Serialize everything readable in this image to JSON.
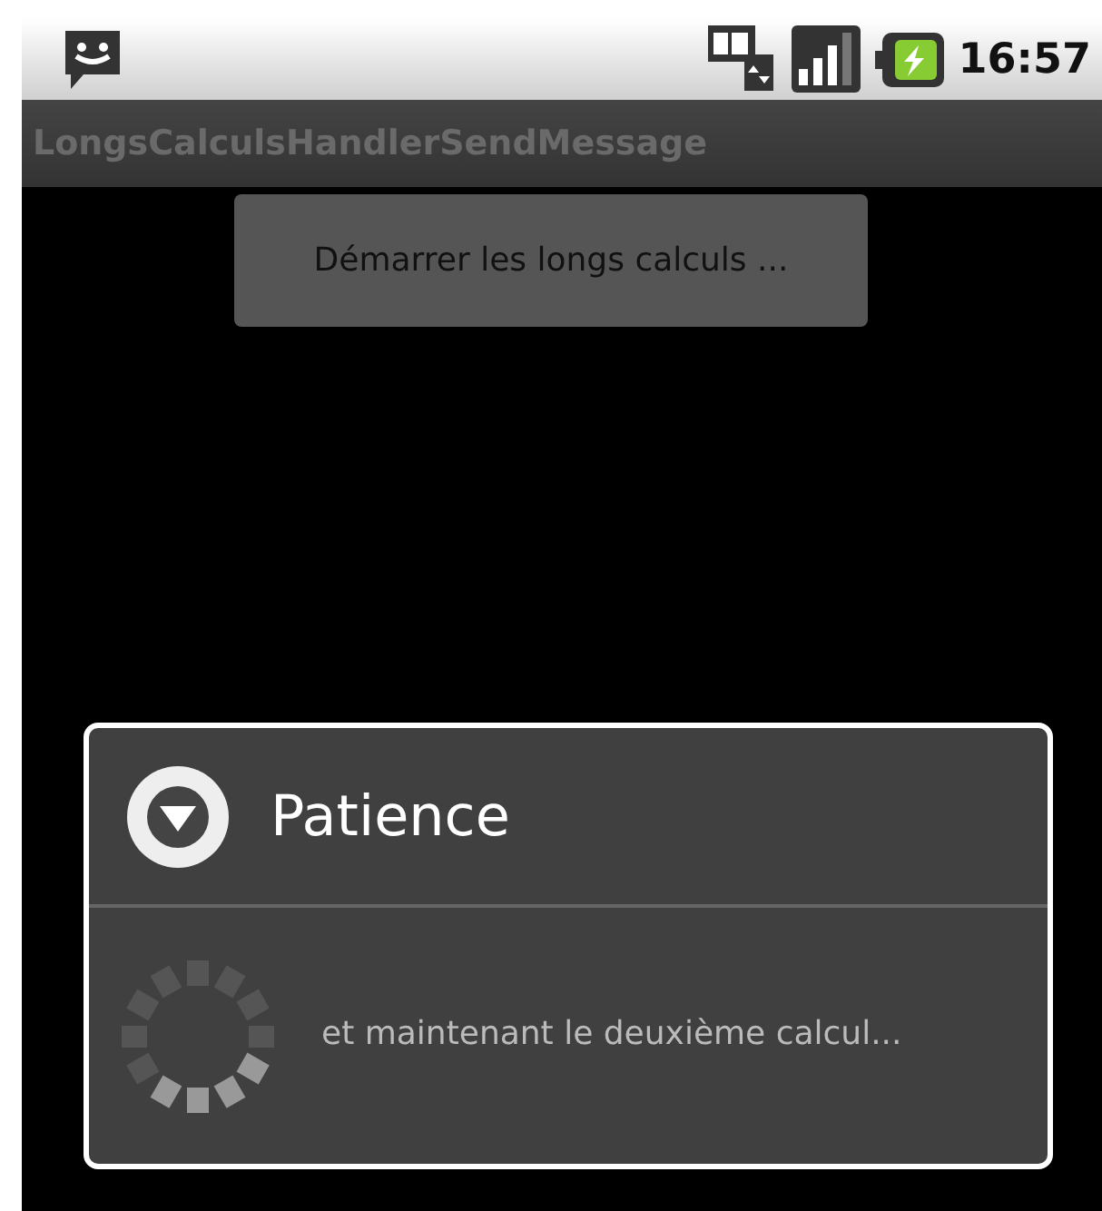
{
  "status_bar": {
    "time": "16:57"
  },
  "app_bar": {
    "title": "LongsCalculsHandlerSendMessage"
  },
  "button": {
    "label": "Démarrer les longs calculs ..."
  },
  "dialog": {
    "title": "Patience",
    "message": "et maintenant le deuxième calcul..."
  }
}
